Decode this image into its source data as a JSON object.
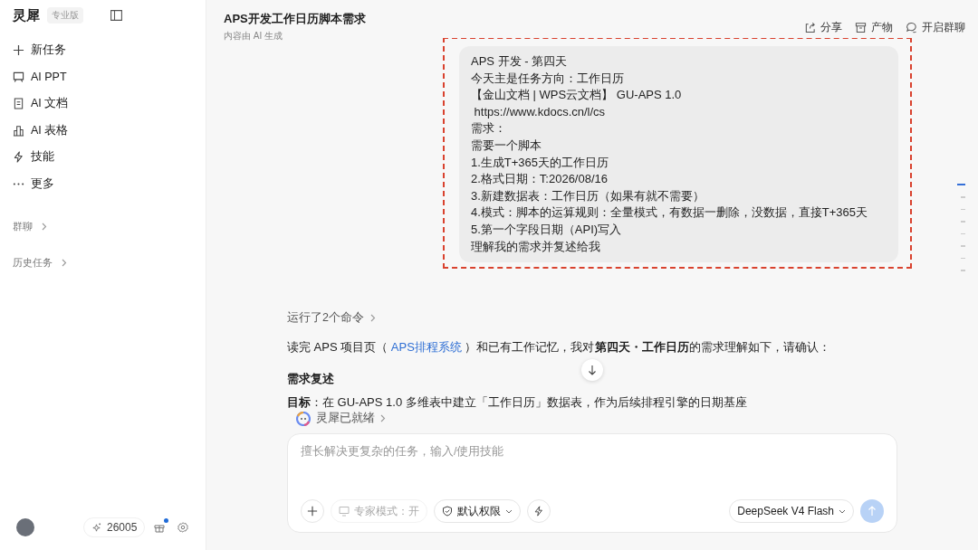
{
  "sidebar": {
    "brand": "灵犀",
    "edition": "专业版",
    "items": [
      {
        "kind": "plus",
        "label": "新任务"
      },
      {
        "kind": "ppt",
        "label": "AI PPT"
      },
      {
        "kind": "doc",
        "label": "AI 文档"
      },
      {
        "kind": "sheet",
        "label": "AI 表格"
      },
      {
        "kind": "bolt",
        "label": "技能"
      },
      {
        "kind": "more",
        "label": "更多"
      }
    ],
    "sections": [
      {
        "label": "群聊"
      },
      {
        "label": "历史任务"
      }
    ],
    "footer": {
      "points": "26005",
      "gift_badge": true
    }
  },
  "header": {
    "title": "APS开发工作日历脚本需求",
    "subtitle": "内容由 AI 生成",
    "actions": [
      {
        "kind": "share",
        "label": "分享"
      },
      {
        "kind": "box",
        "label": "产物"
      },
      {
        "kind": "chat",
        "label": "开启群聊"
      }
    ]
  },
  "message": {
    "lines": [
      "APS 开发 - 第四天",
      "今天主是任务方向：工作日历",
      "【金山文档 | WPS云文档】 GU-APS 1.0",
      " https://www.kdocs.cn/l/cs",
      "需求：",
      "需要一个脚本",
      "1.生成T+365天的工作日历",
      "2.格式日期：T:2026/08/16",
      "3.新建数据表：工作日历（如果有就不需要）",
      "4.模式：脚本的运算规则：全量模式，有数据一删除，没数据，直接T+365天",
      "5.第一个字段日期（API)写入",
      "理解我的需求并复述给我"
    ]
  },
  "reply": {
    "commands": "运行了2个命令",
    "text_before": "读完 APS 项目页（ ",
    "link": "APS排程系统",
    "text_after": " ）和已有工作记忆，我对**第四天・工作日历**的需求理解如下，请确认：",
    "heading": "需求复述",
    "cut_line": "**目标**：在 GU-APS 1.0 多维表中建立「工作日历」数据表，作为后续排程引擎的日期基座"
  },
  "composer": {
    "status": "灵犀已就绪",
    "placeholder": "擅长解决更复杂的任务，输入/使用技能",
    "expert": "专家模式：开",
    "expert_disabled": true,
    "permission": "默认权限",
    "model": "DeepSeek V4 Flash"
  }
}
